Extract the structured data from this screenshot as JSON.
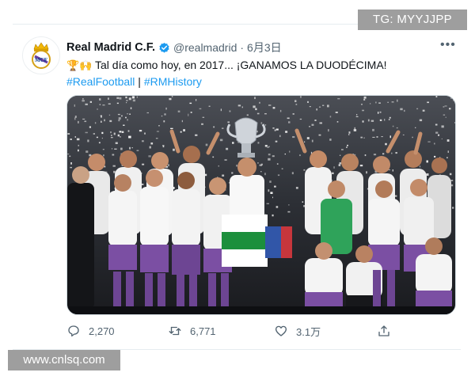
{
  "watermarks": {
    "top": "TG: MYYJJPP",
    "bottom": "www.cnlsq.com"
  },
  "tweet": {
    "author_name": "Real Madrid C.F.",
    "handle": "@realmadrid",
    "separator": "·",
    "date": "6月3日",
    "text": "Tal día como hoy, en 2017... ¡GANAMOS LA DUODÉCIMA!",
    "emoji_prefix": "🏆🙌",
    "hashtags": [
      "#RealFootball",
      "#RMHistory"
    ],
    "hashtag_separator": "|",
    "image_alt": "Real Madrid players celebrating with the Champions League trophy under confetti",
    "colors": {
      "accent": "#1d9bf0",
      "muted": "#536471",
      "kit_white": "#f2f2f2",
      "kit_purple": "#7b4fa3"
    }
  },
  "actions": {
    "replies": "2,270",
    "retweets": "6,771",
    "likes": "3.1万",
    "icons": [
      "reply-icon",
      "retweet-icon",
      "like-icon",
      "share-icon"
    ]
  }
}
